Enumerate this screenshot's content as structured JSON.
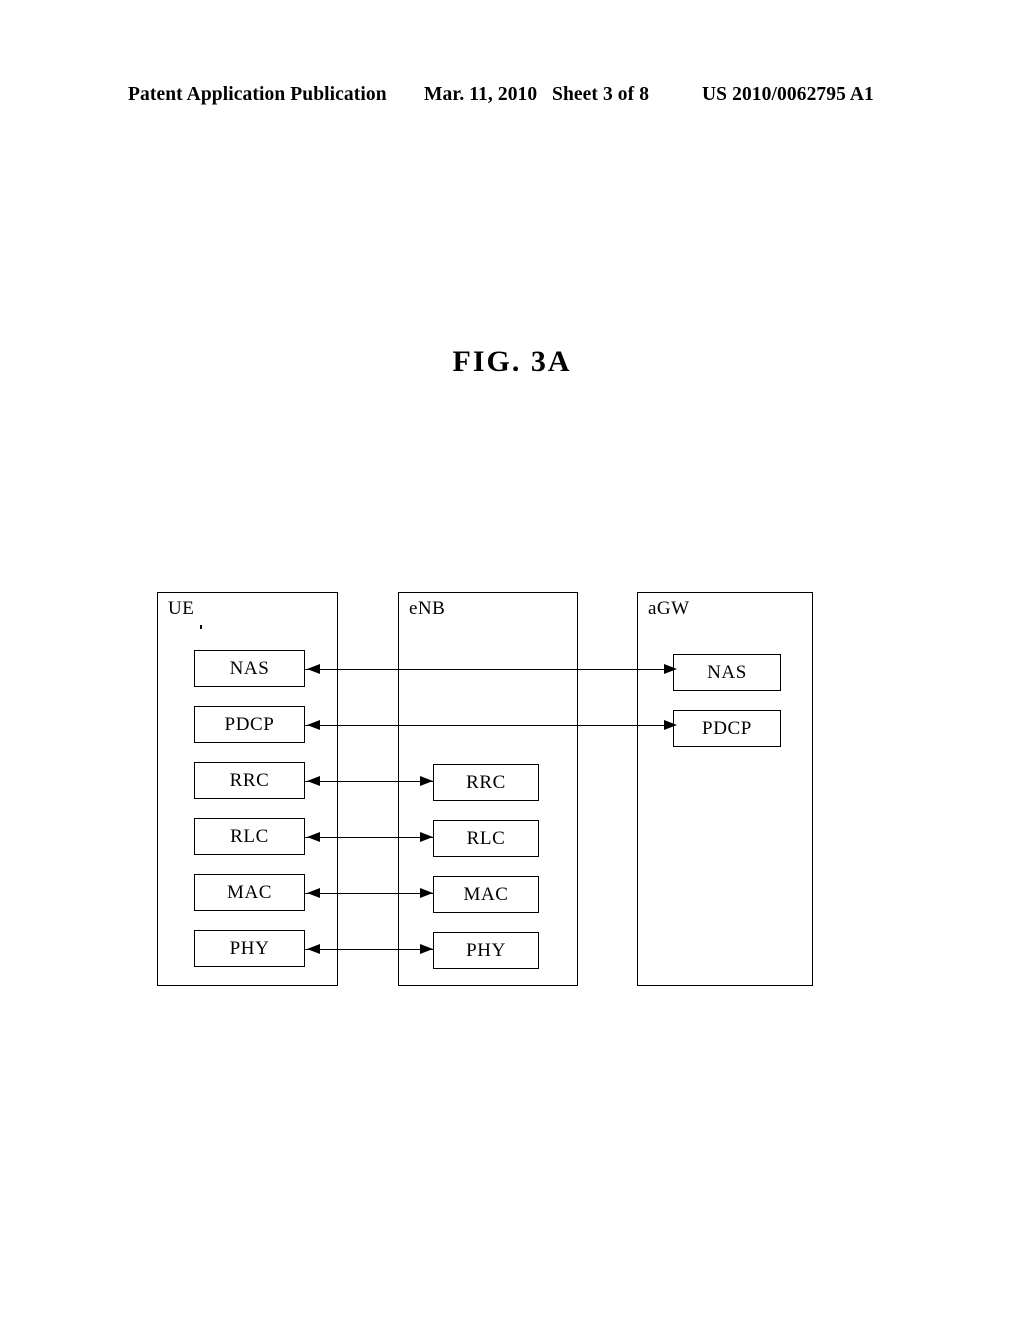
{
  "header": {
    "publication": "Patent Application Publication",
    "date": "Mar. 11, 2010",
    "sheet": "Sheet 3 of 8",
    "document_number": "US 2010/0062795 A1"
  },
  "figure": {
    "title": "FIG. 3A"
  },
  "diagram": {
    "type": "protocol-stack-block-diagram",
    "nodes": [
      {
        "id": "ue",
        "label": "UE",
        "layers": [
          "NAS",
          "PDCP",
          "RRC",
          "RLC",
          "MAC",
          "PHY"
        ]
      },
      {
        "id": "enb",
        "label": "eNB",
        "layers": [
          "RRC",
          "RLC",
          "MAC",
          "PHY"
        ]
      },
      {
        "id": "agw",
        "label": "aGW",
        "layers": [
          "NAS",
          "PDCP"
        ]
      }
    ],
    "connections": [
      {
        "layer": "NAS",
        "from": "ue",
        "to": "agw",
        "direction": "bidirectional"
      },
      {
        "layer": "PDCP",
        "from": "ue",
        "to": "agw",
        "direction": "bidirectional"
      },
      {
        "layer": "RRC",
        "from": "ue",
        "to": "enb",
        "direction": "bidirectional"
      },
      {
        "layer": "RLC",
        "from": "ue",
        "to": "enb",
        "direction": "bidirectional"
      },
      {
        "layer": "MAC",
        "from": "ue",
        "to": "enb",
        "direction": "bidirectional"
      },
      {
        "layer": "PHY",
        "from": "ue",
        "to": "enb",
        "direction": "bidirectional"
      }
    ]
  }
}
